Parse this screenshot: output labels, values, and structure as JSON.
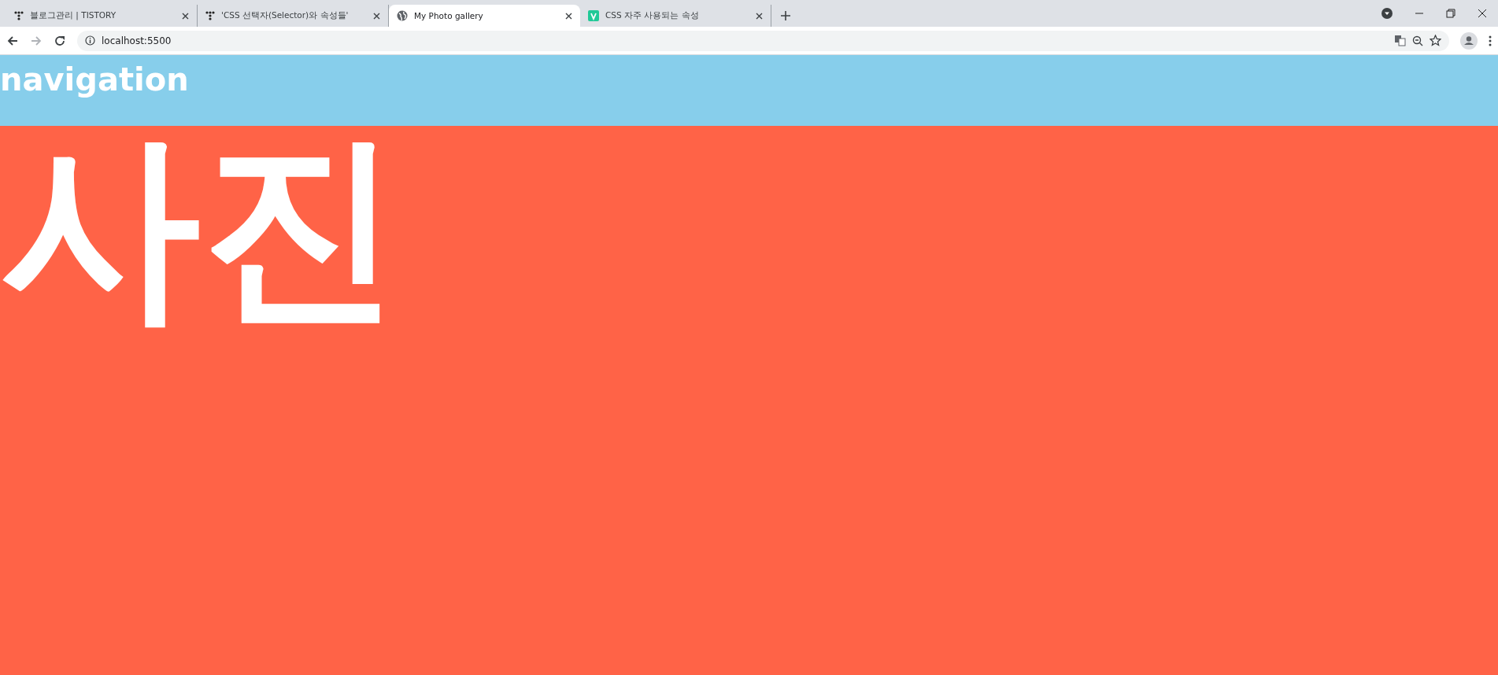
{
  "browser": {
    "tabs": [
      {
        "title": "블로그관리 | TISTORY",
        "kind": "dots",
        "selected": false
      },
      {
        "title": "'CSS 선택자(Selector)와 속성들'",
        "kind": "dots",
        "selected": false
      },
      {
        "title": "My Photo gallery",
        "kind": "globe",
        "selected": true
      },
      {
        "title": "CSS 자주 사용되는 속성",
        "kind": "v",
        "selected": false
      }
    ],
    "address": "localhost:5500"
  },
  "page": {
    "navigation": "navigation",
    "heading": "사진"
  }
}
